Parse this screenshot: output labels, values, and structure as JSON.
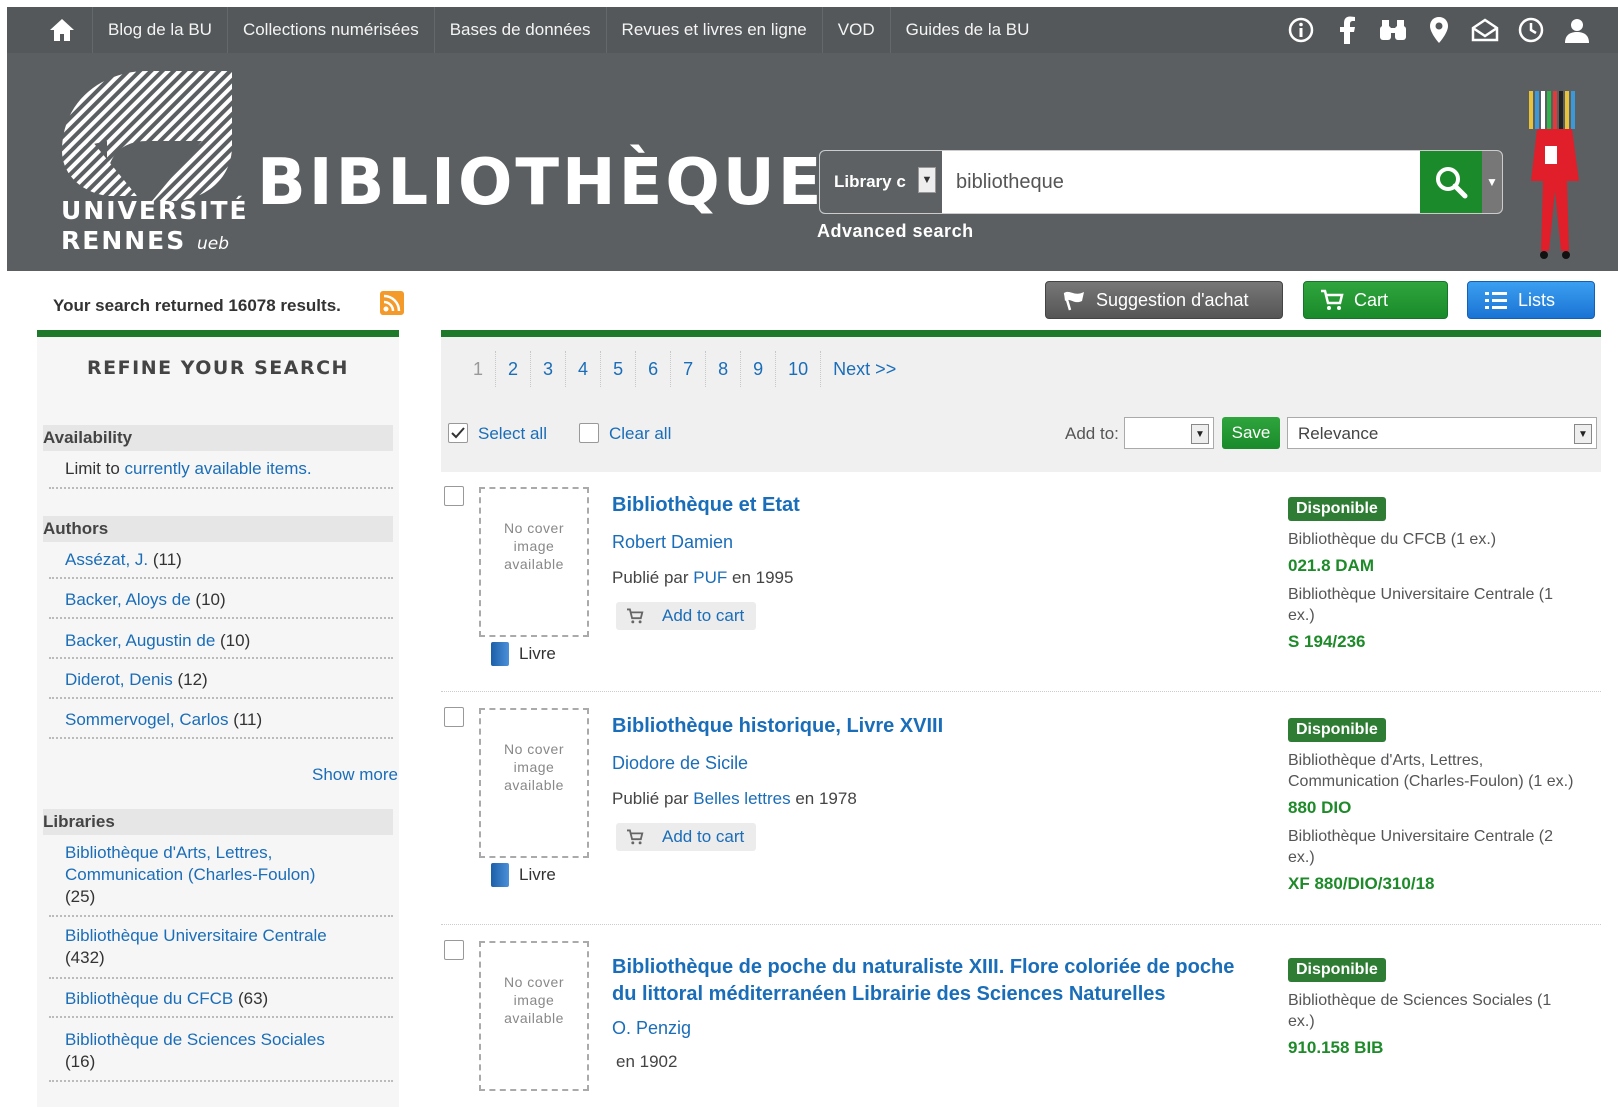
{
  "topnav": {
    "home_icon": "home-icon",
    "items": [
      "Blog de la BU",
      "Collections numérisées",
      "Bases de données",
      "Revues et livres en ligne",
      "VOD",
      "Guides de la BU"
    ],
    "icons": [
      "info-icon",
      "facebook-icon",
      "binoculars-icon",
      "map-pin-icon",
      "mail-icon",
      "clock-icon",
      "user-icon"
    ]
  },
  "header": {
    "logo_line1": "UNIVERSITÉ",
    "logo_line2": "RENNES",
    "logo_ueb": "ueb",
    "site_title": "BIBLIOTHÈQUES",
    "search_scope": "Library c",
    "search_query": "bibliotheque",
    "advanced_search": "Advanced search"
  },
  "toolbar": {
    "result_count": "Your search returned 16078 results.",
    "suggestion": "Suggestion d'achat",
    "cart": "Cart",
    "lists": "Lists"
  },
  "sidebar": {
    "refine_title": "REFINE YOUR SEARCH",
    "availability": {
      "heading": "Availability",
      "prefix": "Limit to ",
      "link": "currently available items."
    },
    "authors": {
      "heading": "Authors",
      "items": [
        {
          "name": "Assézat, J.",
          "count": "(11)"
        },
        {
          "name": "Backer, Aloys de",
          "count": "(10)"
        },
        {
          "name": "Backer, Augustin de",
          "count": "(10)"
        },
        {
          "name": "Diderot, Denis",
          "count": "(12)"
        },
        {
          "name": "Sommervogel, Carlos",
          "count": "(11)"
        }
      ],
      "show_more": "Show more"
    },
    "libraries": {
      "heading": "Libraries",
      "items": [
        {
          "name": "Bibliothèque d'Arts, Lettres, Communication (Charles-Foulon)",
          "count": "(25)"
        },
        {
          "name": "Bibliothèque Universitaire Centrale",
          "count": "(432)"
        },
        {
          "name": "Bibliothèque du CFCB",
          "count": "(63)"
        },
        {
          "name": "Bibliothèque de Sciences Sociales",
          "count": "(16)"
        }
      ]
    }
  },
  "pager": {
    "pages": [
      "1",
      "2",
      "3",
      "4",
      "5",
      "6",
      "7",
      "8",
      "9",
      "10"
    ],
    "next": "Next >>"
  },
  "selection": {
    "select_all": "Select all",
    "clear_all": "Clear all",
    "add_to": "Add to:",
    "save": "Save",
    "sort": "Relevance"
  },
  "results": [
    {
      "cover": "No cover image available",
      "type": "Livre",
      "title": "Bibliothèque et Etat",
      "author": "Robert Damien",
      "pub_prefix": "Publié par ",
      "publisher": "PUF",
      "pub_suffix": " en 1995",
      "add_to_cart": "Add to cart",
      "status": "Disponible",
      "holdings": [
        {
          "library": "Bibliothèque du CFCB (1 ex.)",
          "call": "021.8 DAM"
        },
        {
          "library": "Bibliothèque Universitaire Centrale (1 ex.)",
          "call": "S 194/236"
        }
      ]
    },
    {
      "cover": "No cover image available",
      "type": "Livre",
      "title": "Bibliothèque historique, Livre XVIII",
      "author": "Diodore de Sicile",
      "pub_prefix": "Publié par ",
      "publisher": "Belles lettres",
      "pub_suffix": " en 1978",
      "add_to_cart": "Add to cart",
      "status": "Disponible",
      "holdings": [
        {
          "library": "Bibliothèque d'Arts, Lettres, Communication (Charles-Foulon) (1 ex.)",
          "call": "880 DIO"
        },
        {
          "library": "Bibliothèque Universitaire Centrale (2 ex.)",
          "call": "XF 880/DIO/310/18"
        }
      ]
    },
    {
      "cover": "No cover image available",
      "title": "Bibliothèque de poche du naturaliste XIII. Flore coloriée de poche du littoral méditerranéen Librairie des Sciences Naturelles",
      "author": "O. Penzig",
      "pub_line": "en 1902",
      "status": "Disponible",
      "holdings": [
        {
          "library": "Bibliothèque de Sciences Sociales (1 ex.)",
          "call": "910.158 BIB"
        }
      ]
    }
  ],
  "colors": {
    "accent_green": "#1e7a2a",
    "link_blue": "#1a6db8",
    "header_gray": "#5b5f61"
  }
}
